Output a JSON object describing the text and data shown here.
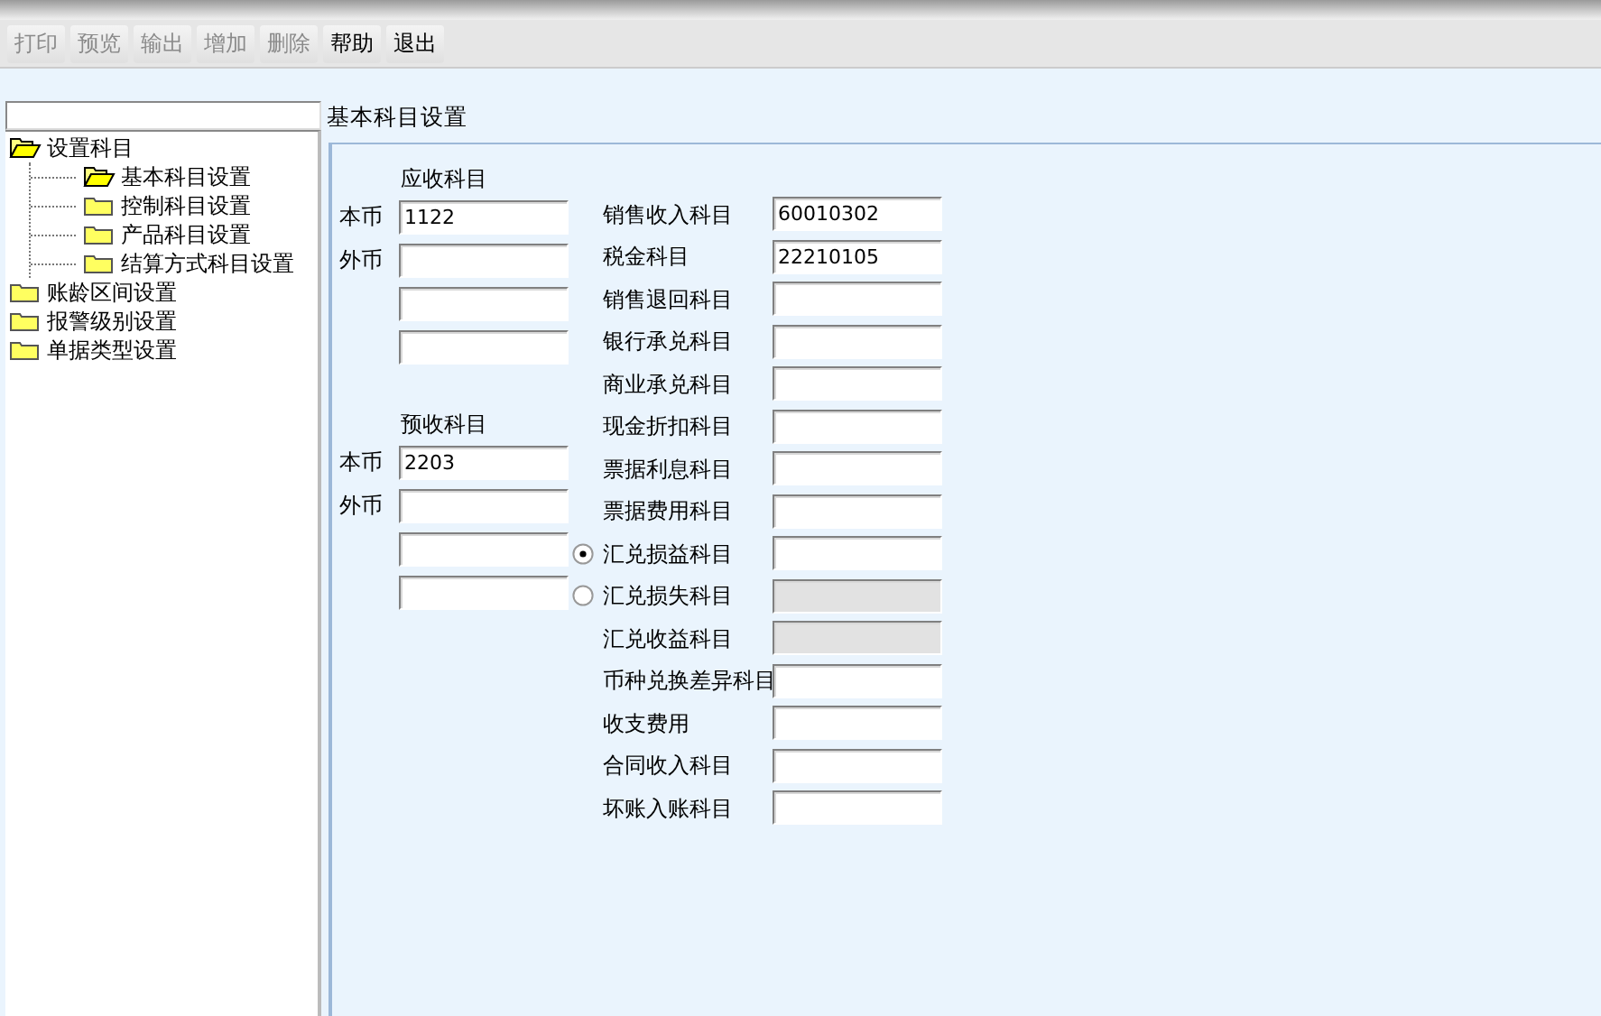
{
  "toolbar": [
    {
      "label": "打印",
      "disabled": true
    },
    {
      "label": "预览",
      "disabled": true
    },
    {
      "label": "输出",
      "disabled": true
    },
    {
      "label": "增加",
      "disabled": true
    },
    {
      "label": "删除",
      "disabled": true
    },
    {
      "label": "帮助",
      "disabled": false
    },
    {
      "label": "退出",
      "disabled": false
    }
  ],
  "tree": [
    {
      "label": "设置科目",
      "open": true,
      "children": [
        {
          "label": "基本科目设置",
          "open": true
        },
        {
          "label": "控制科目设置",
          "open": false
        },
        {
          "label": "产品科目设置",
          "open": false
        },
        {
          "label": "结算方式科目设置",
          "open": false
        }
      ]
    },
    {
      "label": "账龄区间设置",
      "open": false
    },
    {
      "label": "报警级别设置",
      "open": false
    },
    {
      "label": "单据类型设置",
      "open": false
    }
  ],
  "panel_title": "基本科目设置",
  "groups": [
    {
      "title": "应收科目",
      "fields": [
        {
          "kind": "labeled",
          "label": "本币",
          "value": "1122"
        },
        {
          "kind": "labeled",
          "label": "外币"
        },
        {
          "kind": "extra"
        },
        {
          "kind": "extra"
        }
      ]
    },
    {
      "title": "预收科目",
      "fields": [
        {
          "kind": "labeled",
          "label": "本币",
          "value": "2203"
        },
        {
          "kind": "labeled",
          "label": "外币"
        },
        {
          "kind": "extra"
        },
        {
          "kind": "extra"
        }
      ]
    }
  ],
  "accounts": [
    {
      "kind": "text",
      "label": "销售收入科目",
      "value": "60010302",
      "disabled": false
    },
    {
      "kind": "text",
      "label": "税金科目",
      "value": "22210105",
      "disabled": false
    },
    {
      "kind": "text",
      "label": "销售退回科目",
      "disabled": false
    },
    {
      "kind": "text",
      "label": "银行承兑科目",
      "disabled": false
    },
    {
      "kind": "text",
      "label": "商业承兑科目",
      "disabled": false
    },
    {
      "kind": "text",
      "label": "现金折扣科目",
      "disabled": false
    },
    {
      "kind": "text",
      "label": "票据利息科目",
      "disabled": false
    },
    {
      "kind": "text",
      "label": "票据费用科目",
      "disabled": false
    },
    {
      "kind": "radio",
      "selected": true,
      "label": "汇兑损益科目",
      "disabled": false
    },
    {
      "kind": "radio",
      "selected": false,
      "label": "汇兑损失科目",
      "disabled": true
    },
    {
      "kind": "text",
      "label": "汇兑收益科目",
      "disabled": true
    },
    {
      "kind": "text",
      "label": "币种兑换差异科目",
      "disabled": false
    },
    {
      "kind": "text",
      "label": "收支费用",
      "disabled": false
    },
    {
      "kind": "text",
      "label": "合同收入科目",
      "disabled": false
    },
    {
      "kind": "text",
      "label": "坏账入账科目",
      "disabled": false
    }
  ]
}
